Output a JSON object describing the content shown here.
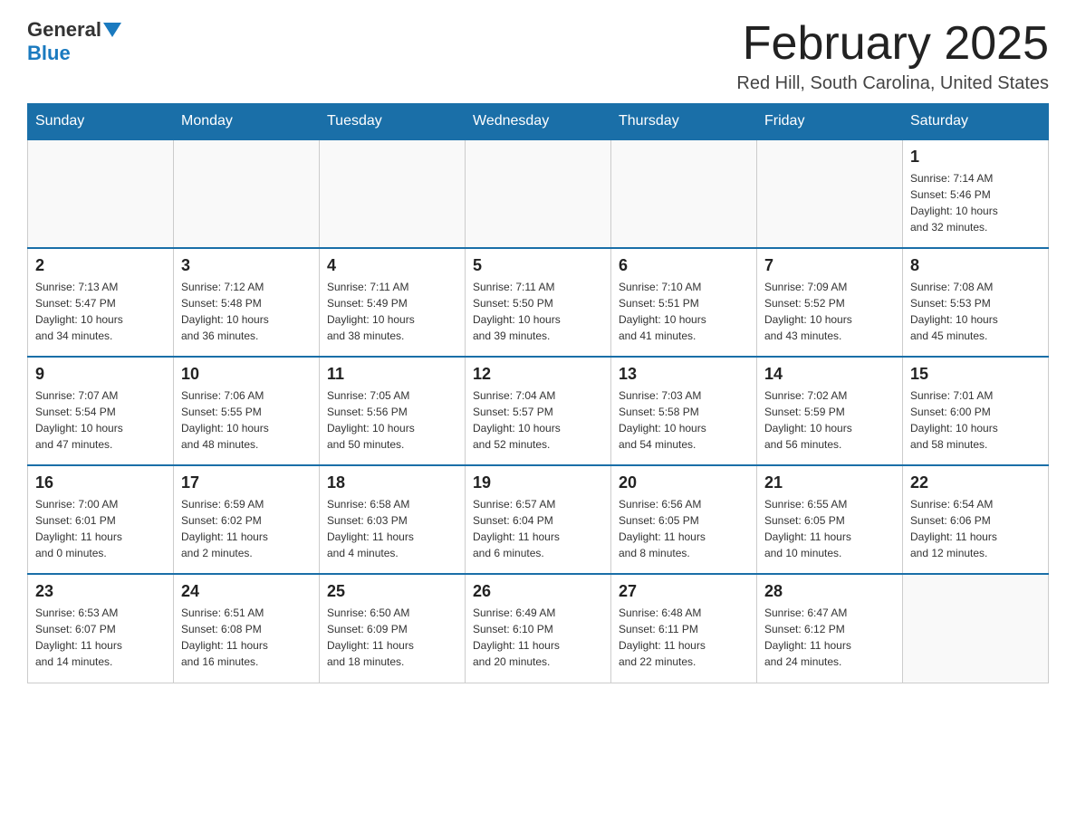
{
  "header": {
    "logo": {
      "part1": "General",
      "part2": "Blue"
    },
    "title": "February 2025",
    "subtitle": "Red Hill, South Carolina, United States"
  },
  "days_of_week": [
    "Sunday",
    "Monday",
    "Tuesday",
    "Wednesday",
    "Thursday",
    "Friday",
    "Saturday"
  ],
  "weeks": [
    [
      {
        "day": "",
        "info": ""
      },
      {
        "day": "",
        "info": ""
      },
      {
        "day": "",
        "info": ""
      },
      {
        "day": "",
        "info": ""
      },
      {
        "day": "",
        "info": ""
      },
      {
        "day": "",
        "info": ""
      },
      {
        "day": "1",
        "info": "Sunrise: 7:14 AM\nSunset: 5:46 PM\nDaylight: 10 hours\nand 32 minutes."
      }
    ],
    [
      {
        "day": "2",
        "info": "Sunrise: 7:13 AM\nSunset: 5:47 PM\nDaylight: 10 hours\nand 34 minutes."
      },
      {
        "day": "3",
        "info": "Sunrise: 7:12 AM\nSunset: 5:48 PM\nDaylight: 10 hours\nand 36 minutes."
      },
      {
        "day": "4",
        "info": "Sunrise: 7:11 AM\nSunset: 5:49 PM\nDaylight: 10 hours\nand 38 minutes."
      },
      {
        "day": "5",
        "info": "Sunrise: 7:11 AM\nSunset: 5:50 PM\nDaylight: 10 hours\nand 39 minutes."
      },
      {
        "day": "6",
        "info": "Sunrise: 7:10 AM\nSunset: 5:51 PM\nDaylight: 10 hours\nand 41 minutes."
      },
      {
        "day": "7",
        "info": "Sunrise: 7:09 AM\nSunset: 5:52 PM\nDaylight: 10 hours\nand 43 minutes."
      },
      {
        "day": "8",
        "info": "Sunrise: 7:08 AM\nSunset: 5:53 PM\nDaylight: 10 hours\nand 45 minutes."
      }
    ],
    [
      {
        "day": "9",
        "info": "Sunrise: 7:07 AM\nSunset: 5:54 PM\nDaylight: 10 hours\nand 47 minutes."
      },
      {
        "day": "10",
        "info": "Sunrise: 7:06 AM\nSunset: 5:55 PM\nDaylight: 10 hours\nand 48 minutes."
      },
      {
        "day": "11",
        "info": "Sunrise: 7:05 AM\nSunset: 5:56 PM\nDaylight: 10 hours\nand 50 minutes."
      },
      {
        "day": "12",
        "info": "Sunrise: 7:04 AM\nSunset: 5:57 PM\nDaylight: 10 hours\nand 52 minutes."
      },
      {
        "day": "13",
        "info": "Sunrise: 7:03 AM\nSunset: 5:58 PM\nDaylight: 10 hours\nand 54 minutes."
      },
      {
        "day": "14",
        "info": "Sunrise: 7:02 AM\nSunset: 5:59 PM\nDaylight: 10 hours\nand 56 minutes."
      },
      {
        "day": "15",
        "info": "Sunrise: 7:01 AM\nSunset: 6:00 PM\nDaylight: 10 hours\nand 58 minutes."
      }
    ],
    [
      {
        "day": "16",
        "info": "Sunrise: 7:00 AM\nSunset: 6:01 PM\nDaylight: 11 hours\nand 0 minutes."
      },
      {
        "day": "17",
        "info": "Sunrise: 6:59 AM\nSunset: 6:02 PM\nDaylight: 11 hours\nand 2 minutes."
      },
      {
        "day": "18",
        "info": "Sunrise: 6:58 AM\nSunset: 6:03 PM\nDaylight: 11 hours\nand 4 minutes."
      },
      {
        "day": "19",
        "info": "Sunrise: 6:57 AM\nSunset: 6:04 PM\nDaylight: 11 hours\nand 6 minutes."
      },
      {
        "day": "20",
        "info": "Sunrise: 6:56 AM\nSunset: 6:05 PM\nDaylight: 11 hours\nand 8 minutes."
      },
      {
        "day": "21",
        "info": "Sunrise: 6:55 AM\nSunset: 6:05 PM\nDaylight: 11 hours\nand 10 minutes."
      },
      {
        "day": "22",
        "info": "Sunrise: 6:54 AM\nSunset: 6:06 PM\nDaylight: 11 hours\nand 12 minutes."
      }
    ],
    [
      {
        "day": "23",
        "info": "Sunrise: 6:53 AM\nSunset: 6:07 PM\nDaylight: 11 hours\nand 14 minutes."
      },
      {
        "day": "24",
        "info": "Sunrise: 6:51 AM\nSunset: 6:08 PM\nDaylight: 11 hours\nand 16 minutes."
      },
      {
        "day": "25",
        "info": "Sunrise: 6:50 AM\nSunset: 6:09 PM\nDaylight: 11 hours\nand 18 minutes."
      },
      {
        "day": "26",
        "info": "Sunrise: 6:49 AM\nSunset: 6:10 PM\nDaylight: 11 hours\nand 20 minutes."
      },
      {
        "day": "27",
        "info": "Sunrise: 6:48 AM\nSunset: 6:11 PM\nDaylight: 11 hours\nand 22 minutes."
      },
      {
        "day": "28",
        "info": "Sunrise: 6:47 AM\nSunset: 6:12 PM\nDaylight: 11 hours\nand 24 minutes."
      },
      {
        "day": "",
        "info": ""
      }
    ]
  ]
}
